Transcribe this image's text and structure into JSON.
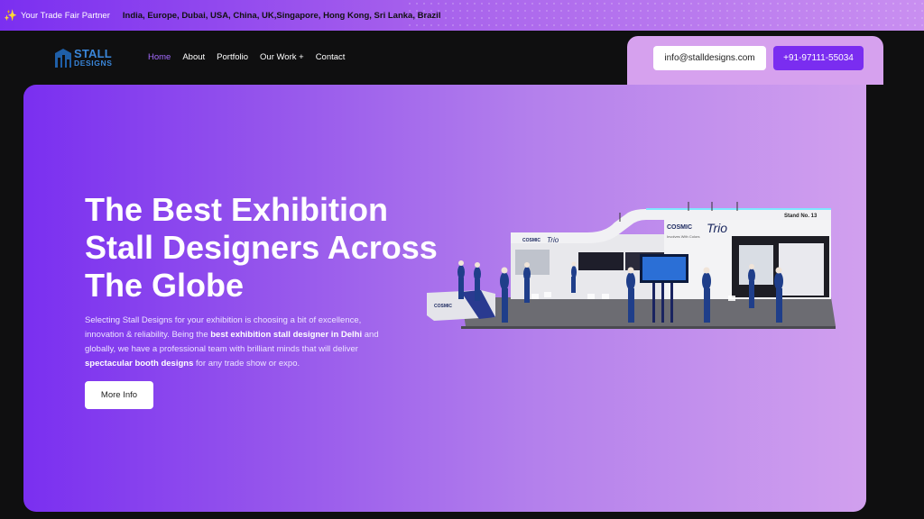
{
  "topbar": {
    "partner": "Your Trade Fair Partner",
    "countries": "India, Europe, Dubai, USA, China, UK,Singapore, Hong Kong, Sri Lanka, Brazil"
  },
  "logo": {
    "line1": "STALL",
    "line2": "DESIGNS"
  },
  "nav": {
    "items": [
      {
        "label": "Home",
        "active": true
      },
      {
        "label": "About"
      },
      {
        "label": "Portfolio"
      },
      {
        "label": "Our Work +"
      },
      {
        "label": "Contact"
      }
    ]
  },
  "contact": {
    "email": "info@stalldesigns.com",
    "phone": "+91-97111-55034"
  },
  "hero": {
    "title": "The Best Exhibition Stall Designers Across The Globe",
    "desc_parts": [
      "Selecting Stall Designs for your exhibition is choosing a bit of excellence, innovation & reliability. Being the ",
      "best exhibition stall designer in Delhi",
      " and globally, we have a professional team with brilliant minds that will deliver ",
      "spectacular booth designs",
      " for any trade show or expo."
    ],
    "button": "More Info"
  },
  "stall": {
    "brand": "COSMIC",
    "brand_script": "Trio",
    "tagline": "Involves With Colors",
    "stand": "Stand No. 13"
  },
  "colors": {
    "accent": "#7a2df0",
    "nav_active": "#a56bff",
    "logo_blue": "#3a86d9"
  }
}
